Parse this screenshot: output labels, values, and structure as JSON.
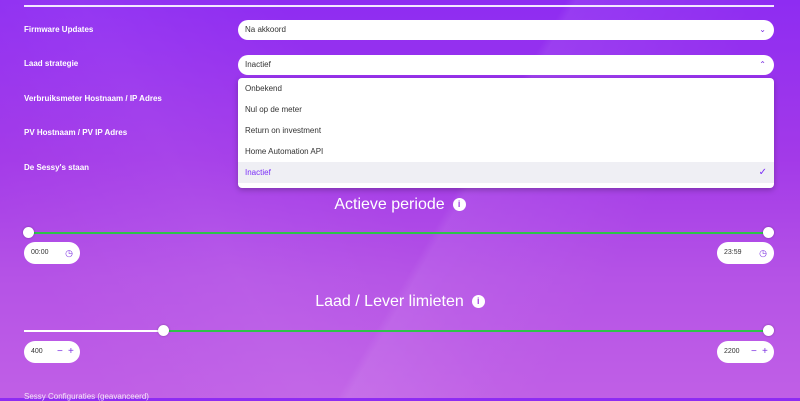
{
  "settings": {
    "firmware": {
      "label": "Firmware Updates",
      "value": "Na akkoord"
    },
    "laad": {
      "label": "Laad strategie",
      "value": "Inactief"
    },
    "meter_label": "Verbruiksmeter Hostnaam / IP Adres",
    "pv_label": "PV Hostnaam / PV IP Adres",
    "sessy_label": "De Sessy's staan"
  },
  "dropdown": {
    "options": [
      "Onbekend",
      "Nul op de meter",
      "Return on investment",
      "Home Automation API",
      "Inactief"
    ],
    "selected": "Inactief"
  },
  "active_period": {
    "title": "Actieve periode",
    "start": "00:00",
    "end": "23:59",
    "range_fraction": [
      0.0,
      1.0
    ]
  },
  "limits": {
    "title": "Laad / Lever limieten",
    "min": "400",
    "max": "2200",
    "range_fraction": [
      0.18,
      1.0
    ]
  },
  "advanced_label": "Sessy Configuraties (geavanceerd)",
  "icons": {
    "chevron": "chevron-down-icon",
    "info": "info-icon",
    "clock": "clock-icon",
    "check": "check-icon",
    "plus": "plus-icon",
    "minus": "minus-icon"
  }
}
